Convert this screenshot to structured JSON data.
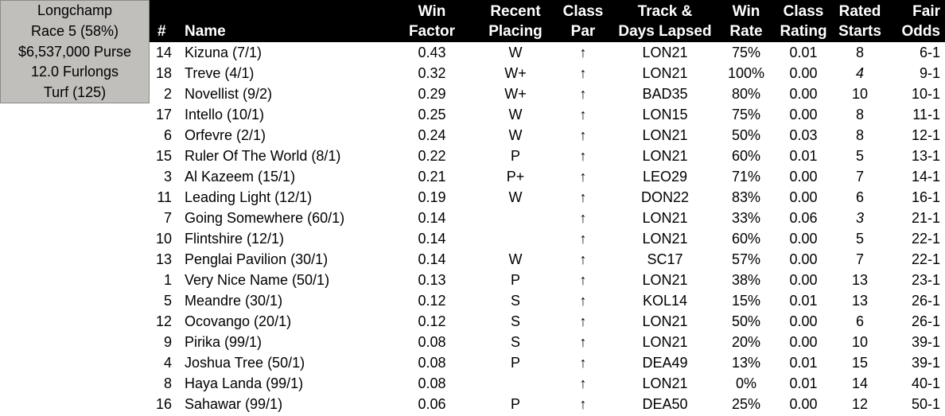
{
  "race": {
    "track": "Longchamp",
    "race_line": "Race 5 (58%)",
    "purse": "$6,537,000 Purse",
    "distance": "12.0 Furlongs",
    "surface": "Turf (125)"
  },
  "columns": {
    "num": "#",
    "name": "Name",
    "win_factor": [
      "Win",
      "Factor"
    ],
    "recent_placing": [
      "Recent",
      "Placing"
    ],
    "class_par": [
      "Class",
      "Par"
    ],
    "track_days": [
      "Track &",
      "Days Lapsed"
    ],
    "win_rate": [
      "Win",
      "Rate"
    ],
    "class_rating": [
      "Class",
      "Rating"
    ],
    "rated_starts": [
      "Rated",
      "Starts"
    ],
    "fair_odds": [
      "Fair",
      "Odds"
    ]
  },
  "colors": {
    "header_bg": "#000000",
    "header_text": "#ffffff",
    "race_box_bg": "#c0bfbb",
    "row_bg": "#ffffff"
  },
  "rows": [
    {
      "num": "14",
      "name": "Kizuna (7/1)",
      "win_factor": "0.43",
      "recent_placing": "W",
      "class_par": "↑",
      "track_days": "LON21",
      "win_rate": "75%",
      "class_rating": "0.01",
      "rated_starts": "8",
      "rated_starts_italic": false,
      "fair_odds": "6-1"
    },
    {
      "num": "18",
      "name": "Treve (4/1)",
      "win_factor": "0.32",
      "recent_placing": "W+",
      "class_par": "↑",
      "track_days": "LON21",
      "win_rate": "100%",
      "class_rating": "0.00",
      "rated_starts": "4",
      "rated_starts_italic": true,
      "fair_odds": "9-1"
    },
    {
      "num": "2",
      "name": "Novellist (9/2)",
      "win_factor": "0.29",
      "recent_placing": "W+",
      "class_par": "↑",
      "track_days": "BAD35",
      "win_rate": "80%",
      "class_rating": "0.00",
      "rated_starts": "10",
      "rated_starts_italic": false,
      "fair_odds": "10-1"
    },
    {
      "num": "17",
      "name": "Intello (10/1)",
      "win_factor": "0.25",
      "recent_placing": "W",
      "class_par": "↑",
      "track_days": "LON15",
      "win_rate": "75%",
      "class_rating": "0.00",
      "rated_starts": "8",
      "rated_starts_italic": false,
      "fair_odds": "11-1"
    },
    {
      "num": "6",
      "name": "Orfevre (2/1)",
      "win_factor": "0.24",
      "recent_placing": "W",
      "class_par": "↑",
      "track_days": "LON21",
      "win_rate": "50%",
      "class_rating": "0.03",
      "rated_starts": "8",
      "rated_starts_italic": false,
      "fair_odds": "12-1"
    },
    {
      "num": "15",
      "name": "Ruler Of The World (8/1)",
      "win_factor": "0.22",
      "recent_placing": "P",
      "class_par": "↑",
      "track_days": "LON21",
      "win_rate": "60%",
      "class_rating": "0.01",
      "rated_starts": "5",
      "rated_starts_italic": false,
      "fair_odds": "13-1"
    },
    {
      "num": "3",
      "name": "Al Kazeem (15/1)",
      "win_factor": "0.21",
      "recent_placing": "P+",
      "class_par": "↑",
      "track_days": "LEO29",
      "win_rate": "71%",
      "class_rating": "0.00",
      "rated_starts": "7",
      "rated_starts_italic": false,
      "fair_odds": "14-1"
    },
    {
      "num": "11",
      "name": "Leading Light (12/1)",
      "win_factor": "0.19",
      "recent_placing": "W",
      "class_par": "↑",
      "track_days": "DON22",
      "win_rate": "83%",
      "class_rating": "0.00",
      "rated_starts": "6",
      "rated_starts_italic": false,
      "fair_odds": "16-1"
    },
    {
      "num": "7",
      "name": "Going Somewhere (60/1)",
      "win_factor": "0.14",
      "recent_placing": "",
      "class_par": "↑",
      "track_days": "LON21",
      "win_rate": "33%",
      "class_rating": "0.06",
      "rated_starts": "3",
      "rated_starts_italic": true,
      "fair_odds": "21-1"
    },
    {
      "num": "10",
      "name": "Flintshire (12/1)",
      "win_factor": "0.14",
      "recent_placing": "",
      "class_par": "↑",
      "track_days": "LON21",
      "win_rate": "60%",
      "class_rating": "0.00",
      "rated_starts": "5",
      "rated_starts_italic": false,
      "fair_odds": "22-1"
    },
    {
      "num": "13",
      "name": "Penglai Pavilion (30/1)",
      "win_factor": "0.14",
      "recent_placing": "W",
      "class_par": "↑",
      "track_days": "SC17",
      "win_rate": "57%",
      "class_rating": "0.00",
      "rated_starts": "7",
      "rated_starts_italic": false,
      "fair_odds": "22-1"
    },
    {
      "num": "1",
      "name": "Very Nice Name (50/1)",
      "win_factor": "0.13",
      "recent_placing": "P",
      "class_par": "↑",
      "track_days": "LON21",
      "win_rate": "38%",
      "class_rating": "0.00",
      "rated_starts": "13",
      "rated_starts_italic": false,
      "fair_odds": "23-1"
    },
    {
      "num": "5",
      "name": "Meandre (30/1)",
      "win_factor": "0.12",
      "recent_placing": "S",
      "class_par": "↑",
      "track_days": "KOL14",
      "win_rate": "15%",
      "class_rating": "0.01",
      "rated_starts": "13",
      "rated_starts_italic": false,
      "fair_odds": "26-1"
    },
    {
      "num": "12",
      "name": "Ocovango (20/1)",
      "win_factor": "0.12",
      "recent_placing": "S",
      "class_par": "↑",
      "track_days": "LON21",
      "win_rate": "50%",
      "class_rating": "0.00",
      "rated_starts": "6",
      "rated_starts_italic": false,
      "fair_odds": "26-1"
    },
    {
      "num": "9",
      "name": "Pirika (99/1)",
      "win_factor": "0.08",
      "recent_placing": "S",
      "class_par": "↑",
      "track_days": "LON21",
      "win_rate": "20%",
      "class_rating": "0.00",
      "rated_starts": "10",
      "rated_starts_italic": false,
      "fair_odds": "39-1"
    },
    {
      "num": "4",
      "name": "Joshua Tree (50/1)",
      "win_factor": "0.08",
      "recent_placing": "P",
      "class_par": "↑",
      "track_days": "DEA49",
      "win_rate": "13%",
      "class_rating": "0.01",
      "rated_starts": "15",
      "rated_starts_italic": false,
      "fair_odds": "39-1"
    },
    {
      "num": "8",
      "name": "Haya Landa (99/1)",
      "win_factor": "0.08",
      "recent_placing": "",
      "class_par": "↑",
      "track_days": "LON21",
      "win_rate": "0%",
      "class_rating": "0.01",
      "rated_starts": "14",
      "rated_starts_italic": false,
      "fair_odds": "40-1"
    },
    {
      "num": "16",
      "name": "Sahawar (99/1)",
      "win_factor": "0.06",
      "recent_placing": "P",
      "class_par": "↑",
      "track_days": "DEA50",
      "win_rate": "25%",
      "class_rating": "0.00",
      "rated_starts": "12",
      "rated_starts_italic": false,
      "fair_odds": "50-1"
    }
  ]
}
